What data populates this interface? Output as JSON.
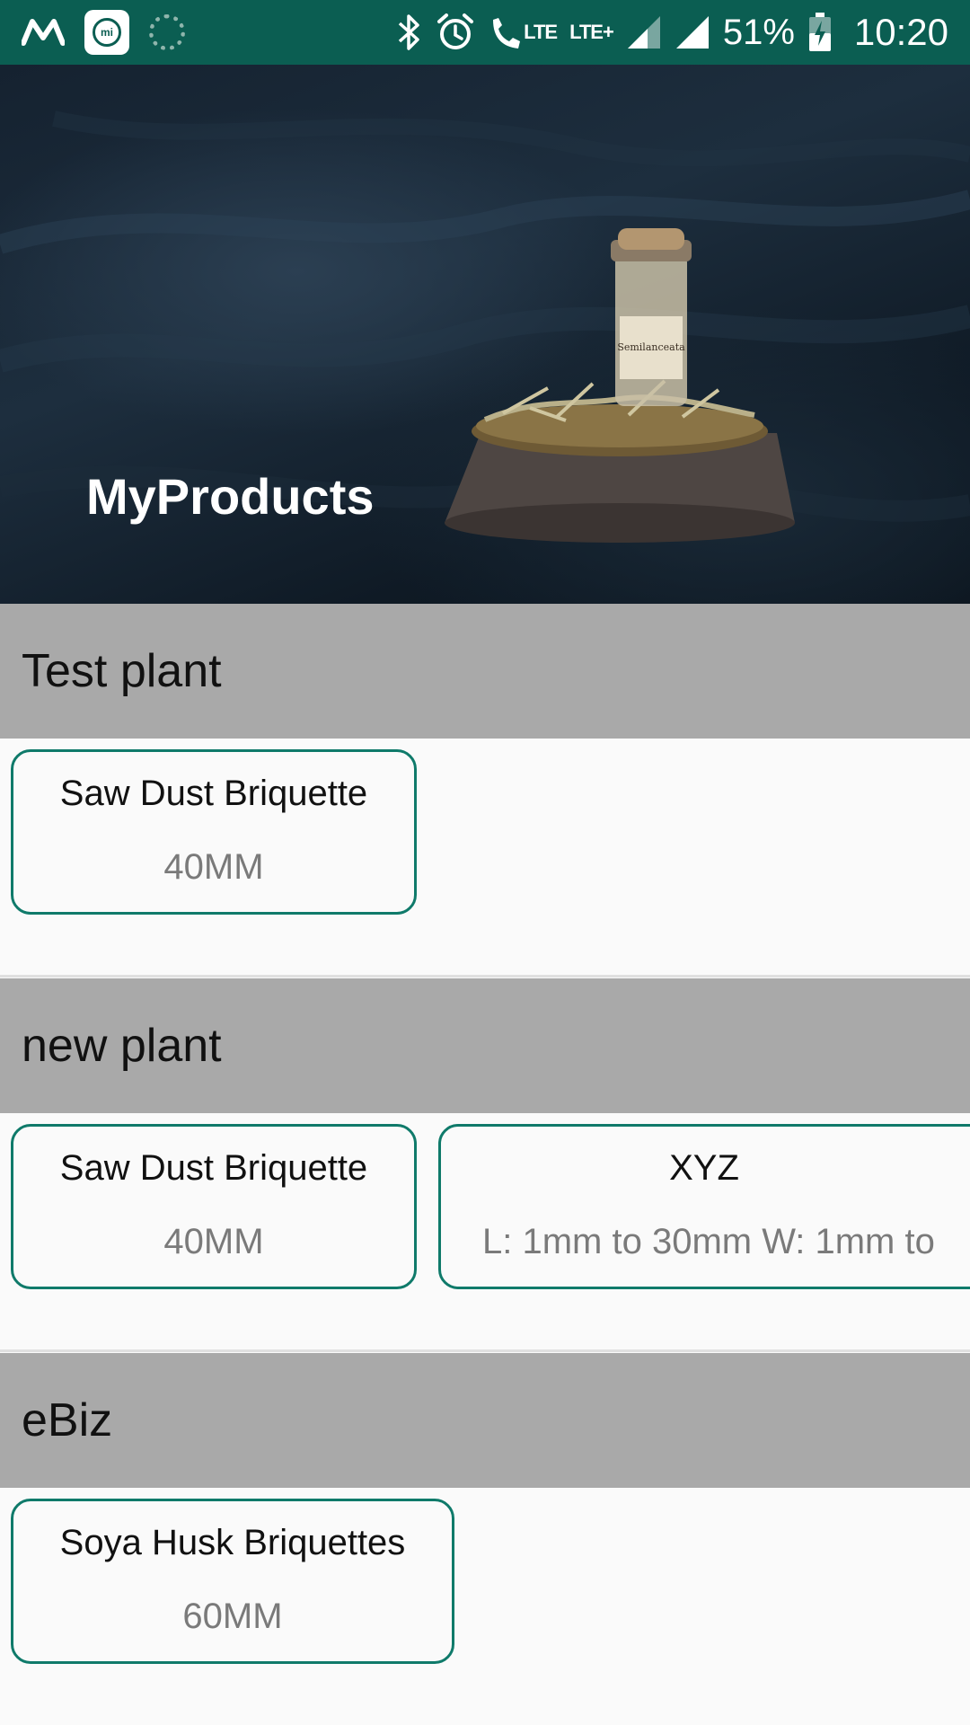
{
  "status_bar": {
    "battery_percent": "51%",
    "time": "10:20",
    "network_label_1": "LTE",
    "network_label_2": "LTE+",
    "icons": [
      "motorola-icon",
      "mi-icon",
      "loader-icon",
      "bluetooth-icon",
      "alarm-icon",
      "volte-call-icon",
      "signal-icon",
      "signal-icon",
      "battery-charging-icon"
    ]
  },
  "header": {
    "title": "MyProducts",
    "image_label": "Semilanceata"
  },
  "sections": [
    {
      "title": "Test plant",
      "products": [
        {
          "name": "Saw Dust Briquette",
          "spec": "40MM"
        }
      ]
    },
    {
      "title": "new plant",
      "products": [
        {
          "name": "Saw Dust Briquette",
          "spec": "40MM"
        },
        {
          "name": "XYZ",
          "spec": "L: 1mm to 30mm W: 1mm to"
        }
      ]
    },
    {
      "title": "eBiz",
      "products": [
        {
          "name": "Soya Husk Briquettes",
          "spec": "60MM"
        }
      ]
    }
  ],
  "colors": {
    "status_bar": "#0b5e52",
    "section_header": "#a9a9a9",
    "card_border": "#0f7a6a",
    "background": "#fafafa"
  }
}
